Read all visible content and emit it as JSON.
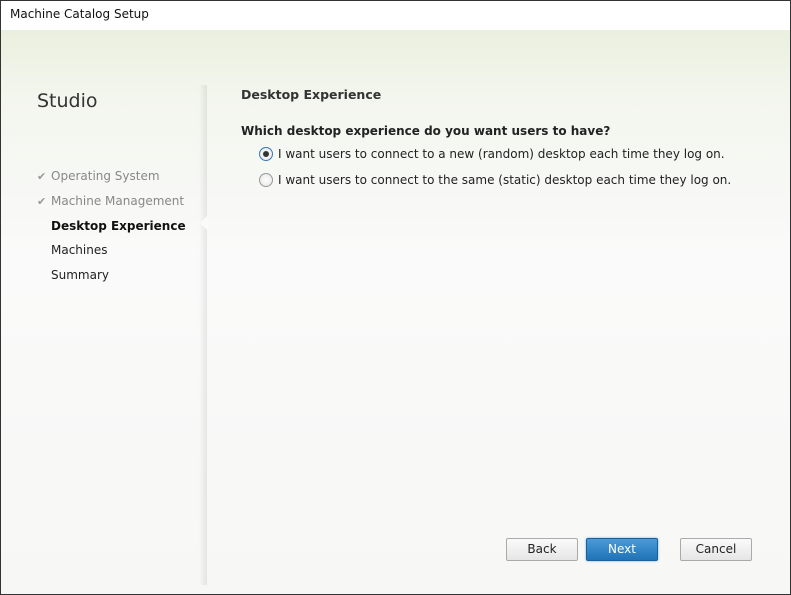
{
  "window": {
    "title": "Machine Catalog Setup"
  },
  "sidebar": {
    "brand": "Studio",
    "steps": [
      {
        "label": "Operating System",
        "state": "done"
      },
      {
        "label": "Machine Management",
        "state": "done"
      },
      {
        "label": "Desktop Experience",
        "state": "current"
      },
      {
        "label": "Machines",
        "state": "pending"
      },
      {
        "label": "Summary",
        "state": "pending"
      }
    ]
  },
  "main": {
    "heading": "Desktop Experience",
    "question": "Which desktop experience do you want users to have?",
    "options": [
      {
        "label": "I want users to connect to a new (random) desktop each time they log on.",
        "selected": true
      },
      {
        "label": "I want users to connect to the same (static) desktop each time they log on.",
        "selected": false
      }
    ]
  },
  "buttons": {
    "back": "Back",
    "next": "Next",
    "cancel": "Cancel"
  }
}
